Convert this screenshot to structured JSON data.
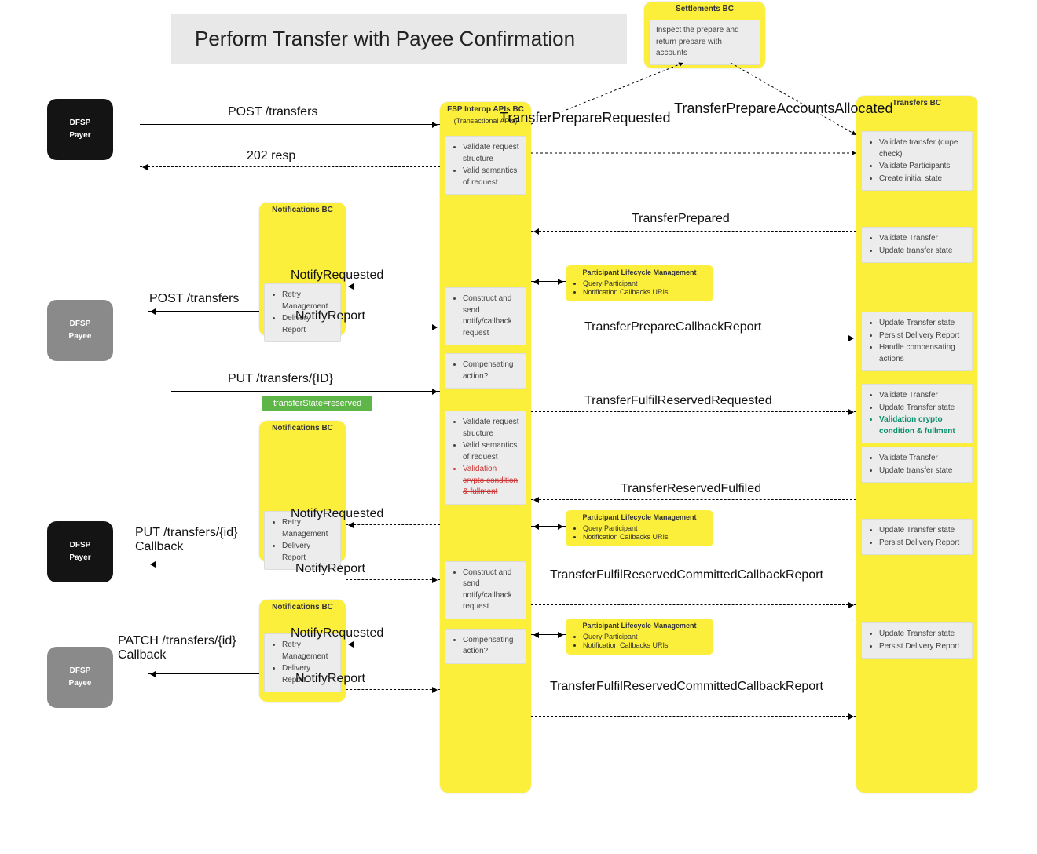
{
  "title": "Perform Transfer with Payee Confirmation",
  "actors": {
    "payer1": {
      "l1": "DFSP",
      "l2": "Payer"
    },
    "payee1": {
      "l1": "DFSP",
      "l2": "Payee"
    },
    "payer2": {
      "l1": "DFSP",
      "l2": "Payer"
    },
    "payee2": {
      "l1": "DFSP",
      "l2": "Payee"
    }
  },
  "bc": {
    "settlements": {
      "title": "Settlements BC",
      "note": "Inspect the prepare and return prepare with accounts"
    },
    "interop": {
      "title": "FSP Interop APIs BC",
      "sub": "(Transactional APIs)"
    },
    "transfers": {
      "title": "Transfers BC"
    },
    "notif": {
      "title": "Notifications BC"
    }
  },
  "interop_notes": {
    "n1a": "Validate request structure",
    "n1b": "Valid semantics of request",
    "n2": "Construct and send notify/callback request",
    "n3": "Compensating action?",
    "n4a": "Validate request structure",
    "n4b": "Valid semantics of request",
    "n4c": "Validation crypto condition & fullment",
    "n5": "Construct and send notify/callback request",
    "n6": "Compensating action?"
  },
  "transfers_notes": {
    "t1a": "Validate transfer (dupe check)",
    "t1b": "Validate Participants",
    "t1c": "Create initial state",
    "t2a": "Validate Transfer",
    "t2b": "Update transfer state",
    "t3a": "Update Transfer state",
    "t3b": "Persist Delivery Report",
    "t3c": "Handle compensating actions",
    "t4a": "Validate Transfer",
    "t4b": "Update Transfer state",
    "t4c": "Validation crypto condition & fullment",
    "t5a": "Validate Transfer",
    "t5b": "Update transfer state",
    "t6a": "Update Transfer state",
    "t6b": "Persist Delivery Report",
    "t7a": "Update Transfer state",
    "t7b": "Persist Delivery Report"
  },
  "notif_notes": {
    "a": "Retry Management",
    "b": "Delivery Report"
  },
  "plm": {
    "title": "Participant Lifecycle Management",
    "a": "Query Participant",
    "b": "Notification Callbacks URIs"
  },
  "messages": {
    "post_transfers": "POST /transfers",
    "resp_202": "202 resp",
    "transfer_prep_req": "TransferPrepareRequested",
    "transfer_prep_alloc": "TransferPrepareAccountsAllocated",
    "transfer_prepared": "TransferPrepared",
    "notify_requested": "NotifyRequested",
    "notify_report": "NotifyReport",
    "post_transfers2": "POST /transfers",
    "transfer_prep_cb": "TransferPrepareCallbackReport",
    "put_transfers_id": "PUT /transfers/{ID}",
    "transfer_state_reserved": "transferState=reserved",
    "transfer_fulfil_reserved_req": "TransferFulfilReservedRequested",
    "transfer_reserved_fulfiled": "TransferReservedFulfiled",
    "put_transfers_id_cb": "PUT /transfers/{id} Callback",
    "transfer_fulfil_committed_cb": "TransferFulfilReservedCommittedCallbackReport",
    "patch_transfers_id_cb": "PATCH /transfers/{id} Callback",
    "transfer_fulfil_committed_cb2": "TransferFulfilReservedCommittedCallbackReport"
  }
}
